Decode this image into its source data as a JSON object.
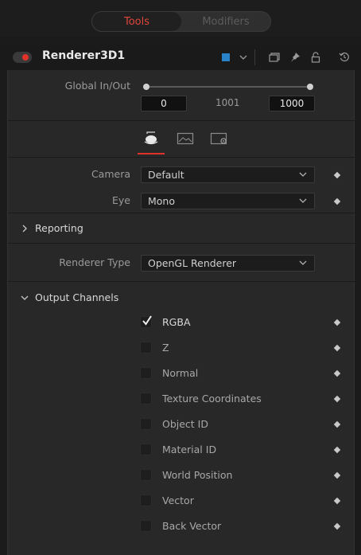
{
  "tabs": {
    "tools": "Tools",
    "modifiers": "Modifiers"
  },
  "node": {
    "name": "Renderer3D1",
    "color": "#2a82c8"
  },
  "global_inout": {
    "label": "Global In/Out",
    "in_value": "0",
    "mid_value": "1001",
    "out_value": "1000"
  },
  "camera": {
    "label": "Camera",
    "value": "Default"
  },
  "eye": {
    "label": "Eye",
    "value": "Mono"
  },
  "reporting": {
    "title": "Reporting"
  },
  "renderer_type": {
    "label": "Renderer Type",
    "value": "OpenGL Renderer"
  },
  "output_channels": {
    "title": "Output Channels",
    "items": [
      {
        "label": "RGBA",
        "checked": true
      },
      {
        "label": "Z",
        "checked": false
      },
      {
        "label": "Normal",
        "checked": false
      },
      {
        "label": "Texture Coordinates",
        "checked": false
      },
      {
        "label": "Object ID",
        "checked": false
      },
      {
        "label": "Material ID",
        "checked": false
      },
      {
        "label": "World Position",
        "checked": false
      },
      {
        "label": "Vector",
        "checked": false
      },
      {
        "label": "Back Vector",
        "checked": false
      }
    ]
  },
  "icons": {
    "enable_toggle": "enable-toggle",
    "color_swatch": "color-swatch",
    "dropdown": "chevron-down-icon",
    "versions": "versions-icon",
    "pin": "pin-icon",
    "lock": "lock-icon",
    "reset": "reset-icon",
    "controls_tab": "controls-tab-icon",
    "image_tab": "image-tab-icon",
    "settings_tab": "settings-tab-icon"
  },
  "colors": {
    "accent": "#e0322a",
    "panel": "#282828",
    "background": "#1b1b1b"
  }
}
